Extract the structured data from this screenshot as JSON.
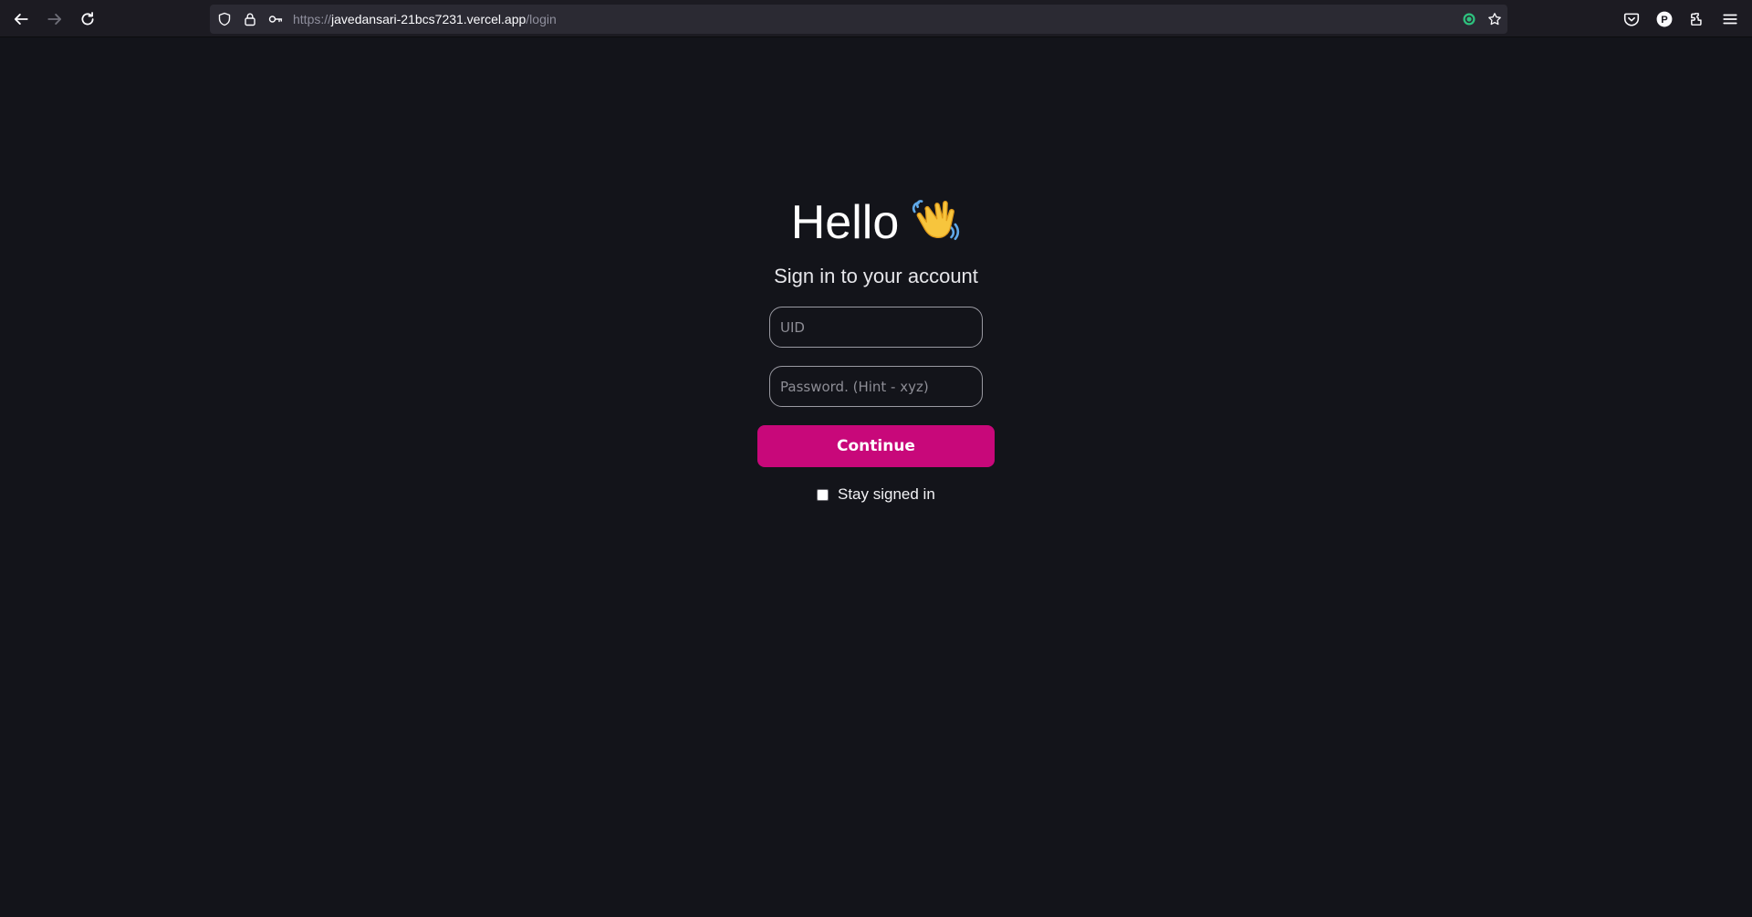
{
  "browser": {
    "url_scheme": "https://",
    "url_host": "javedansari-21bcs7231.vercel.app",
    "url_path": "/login",
    "icons": [
      "back-arrow-icon",
      "forward-arrow-icon",
      "reload-icon",
      "shield-icon",
      "lock-icon",
      "key-icon",
      "extension-record-icon",
      "bookmark-star-icon",
      "pocket-icon",
      "account-icon",
      "extensions-icon",
      "menu-icon"
    ],
    "account_initial": "P"
  },
  "login": {
    "title": "Hello",
    "subtitle": "Sign in to your account",
    "uid_placeholder": "UID",
    "password_placeholder": "Password. (Hint - xyz)",
    "continue_label": "Continue",
    "stay_signed_in_label": "Stay signed in",
    "stay_signed_in_checked": false
  },
  "colors": {
    "background": "#13141a",
    "accent": "#c8087a",
    "toolbar": "#1c1b22"
  }
}
